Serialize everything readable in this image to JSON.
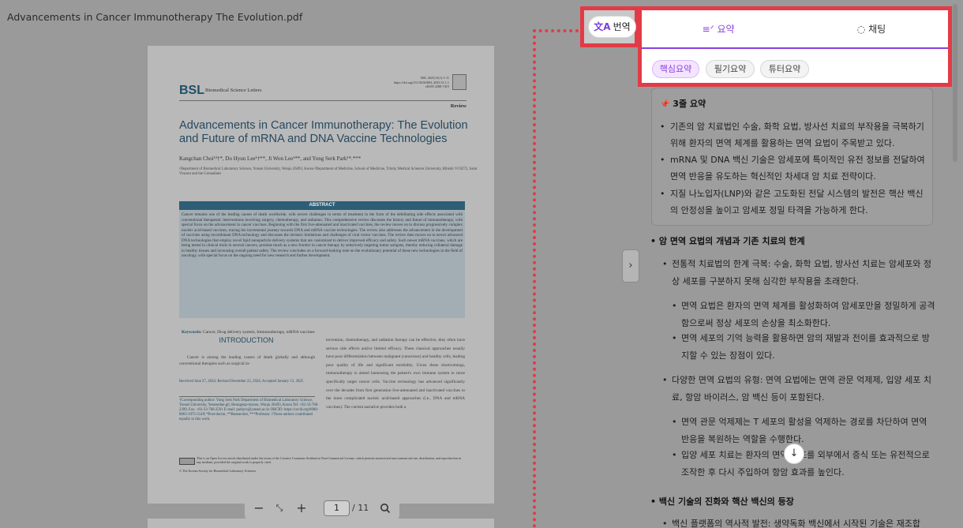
{
  "viewer": {
    "file_title": "Advancements in Cancer Immunotherapy The Evolution.pdf",
    "page": {
      "journal_abbr": "BSL",
      "journal_name": "Biomedical Science Letters",
      "doi_block": "BSL 2025;31(1):1-11 https://doi.org/10.15616/BSL.2025.31.1.1 eISSN 2288-7415",
      "article_type": "Review",
      "title": "Advancements in Cancer Immunotherapy: The Evolution and Future of mRNA and DNA Vaccine Technologies",
      "authors": "Kangchan Choi¹²†*, Do Hyun Lee¹†**, Ji Won Lee¹**, and Yong Serk Park¹*.***",
      "affiliations": "¹Department of Biomedical Laboratory Science, Yonsei University, Wonju 26493, Korea ²Department of Medicine, School of Medicine, Trinity Medical Sciences University, Ribishi VC0272, Saint Vincent and the Grenadines",
      "abstract_heading": "ABSTRACT",
      "abstract": "Cancer remains one of the leading causes of death worldwide, with severe challenges in terms of treatment in the form of the debilitating side effects associated with conventional therapeutic interventions involving surgery, chemotherapy, and radiation. This comprehensive review discusses the history and future of immunotherapy, with special focus on the advancement in cancer vaccines. Beginning with the first live-attenuated and inactivated vaccines, the review moves on to discuss progressively complex nucleic acid-based vaccines, tracing the incremental journey towards DNA and mRNA vaccine technologies. The review also addresses the advancement in the development of vaccines using recombinant DNA technology and discusses the intrinsic limitations and challenges of viral vector vaccines. The review then moves on to newer advanced DNA technologies that employ novel lipid nanoparticle delivery systems that are customized to deliver improved efficacy and safety. Such newer mRNA vaccines, which are being tested in clinical trials in several cancers, promise much as a new frontier in cancer therapy by selectively targeting tumor antigens, thereby reducing collateral damage to healthy tissues and increasing overall patient safety. The review concludes on a forward-looking note on the evolutionary potential of these new technologies in the field of oncology, with special focus on the ongoing need for new research and further development.",
      "keywords_label": "Keywords:",
      "keywords": "Cancer, Drug delivery system, Immunotherapy, mRNA vaccines",
      "intro_heading": "INTRODUCTION",
      "intro_col1": "Cancer is among the leading causes of death globally and although conventional therapies such as surgical in-",
      "received": "Received June 27, 2024; Revised December 22, 2024; Accepted January 13, 2025",
      "corresponding": "†Corresponding author: Yong Serk Park Department of Biomedical Laboratory Science, Yonsei University, Yeonsedae-gil, Heungeop-myeon, Wonju 26493, Korea Tel: +82-33-760-2399, Fax: +82-33-760-2561 E-mail: parkyrs@yonsei.ac.kr ORCID: https://orcid.org/0000-0003-1975-514X *Post-doctor, **Researcher, ***Professor. †These authors contributed equally to this work.",
      "license": "This is an Open Access article distributed under the terms of the Creative Commons Attribution Non-Commercial License, which permits unrestricted non-commercial use, distribution, and reproduction in any medium, provided the original work is properly cited.",
      "society": "© The Korean Society for Biomedical Laboratory Sciences.",
      "intro_col2": "tervention, chemotherapy, and radiation therapy can be effective, they often have serious side effects and/or limited efficacy. These classical approaches usually have poor differentiation between malignant (cancerous) and healthy cells, leading poor quality of life and significant morbidity. Given these shortcomings, immunotherapy is aimed harnessing the patient's own immune system to more specifically target cancer cells. Vaccine technology has advanced significantly over the decades from first generation live-attenuated and inactivated vaccines to the more complicated nucleic acid-based approaches (i.e., DNA and mRNA vaccines). The current narrative provides both a"
    },
    "toolbar": {
      "current_page": "1",
      "total_pages": "/ 11"
    },
    "translate_label": "번역"
  },
  "panel": {
    "tabs": [
      {
        "label": "요약"
      },
      {
        "label": "채팅"
      }
    ],
    "chips": [
      "핵심요약",
      "필기요약",
      "튜터요약"
    ],
    "summary_title": "3줄 요약",
    "summary_bullets": [
      "기존의 암 치료법인 수술, 화학 요법, 방사선 치료의 부작용을 극복하기 위해 환자의 면역 체계를 활용하는 면역 요법이 주목받고 있다.",
      "mRNA 및 DNA 백신 기술은 암세포에 특이적인 유전 정보를 전달하여 면역 반응을 유도하는 혁신적인 차세대 암 치료 전략이다.",
      "지질 나노입자(LNP)와 같은 고도화된 전달 시스템의 발전은 핵산 백신의 안정성을 높이고 암세포 정밀 타격을 가능하게 한다."
    ],
    "sections": [
      {
        "title": "암 면역 요법의 개념과 기존 치료의 한계",
        "b1": "전통적 치료법의 한계 극복: 수술, 화학 요법, 방사선 치료는 암세포와 정상 세포를 구분하지 못해 심각한 부작용을 초래한다.",
        "b1a": "면역 요법은 환자의 면역 체계를 활성화하여 암세포만을 정밀하게 공격함으로써 정상 세포의 손상을 최소화한다.",
        "b1b": "면역 세포의 기억 능력을 활용하면 암의 재발과 전이를 효과적으로 방지할 수 있는 장점이 있다.",
        "b2": "다양한 면역 요법의 유형: 면역 요법에는 면역 관문 억제제, 입양 세포 치료, 항암 바이러스, 암 백신 등이 포함된다.",
        "b2a": "면역 관문 억제제는 T 세포의 활성을 억제하는 경로를 차단하여 면역 반응을 복원하는 역할을 수행한다.",
        "b2b": "입양 세포 치료는 환자의 면역 세포를 외부에서 증식 또는 유전적으로 조작한 후 다시 주입하여 항암 효과를 높인다."
      },
      {
        "title": "백신 기술의 진화와 핵산 백신의 등장",
        "b1": "백신 플랫폼의 역사적 발전: 생약독화 백신에서 시작된 기술은 재조합"
      }
    ]
  }
}
